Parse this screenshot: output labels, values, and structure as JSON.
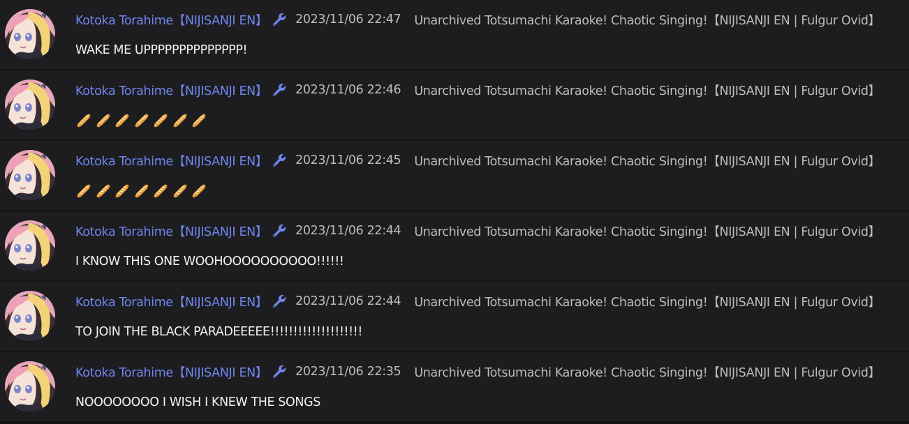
{
  "messages": [
    {
      "author": "Kotoka Torahime【NIJISANJI EN】",
      "badge_icon": "wrench-icon",
      "timestamp": "2023/11/06 22:47",
      "source": "Unarchived Totsumachi Karaoke! Chaotic Singing!【NIJISANJI EN | Fulgur Ovid】",
      "text": "WAKE ME UPPPPPPPPPPPPPP!"
    },
    {
      "author": "Kotoka Torahime【NIJISANJI EN】",
      "badge_icon": "wrench-icon",
      "timestamp": "2023/11/06 22:46",
      "source": "Unarchived Totsumachi Karaoke! Chaotic Singing!【NIJISANJI EN | Fulgur Ovid】",
      "emoji_name": "baguette-bread-icon",
      "emoji_count": 7
    },
    {
      "author": "Kotoka Torahime【NIJISANJI EN】",
      "badge_icon": "wrench-icon",
      "timestamp": "2023/11/06 22:45",
      "source": "Unarchived Totsumachi Karaoke! Chaotic Singing!【NIJISANJI EN | Fulgur Ovid】",
      "emoji_name": "baguette-bread-icon",
      "emoji_count": 7
    },
    {
      "author": "Kotoka Torahime【NIJISANJI EN】",
      "badge_icon": "wrench-icon",
      "timestamp": "2023/11/06 22:44",
      "source": "Unarchived Totsumachi Karaoke! Chaotic Singing!【NIJISANJI EN | Fulgur Ovid】",
      "text": "I KNOW THIS ONE WOOHOOOOOOOOOO!!!!!!"
    },
    {
      "author": "Kotoka Torahime【NIJISANJI EN】",
      "badge_icon": "wrench-icon",
      "timestamp": "2023/11/06 22:44",
      "source": "Unarchived Totsumachi Karaoke! Chaotic Singing!【NIJISANJI EN | Fulgur Ovid】",
      "text": "TO JOIN THE BLACK PARADEEEEE!!!!!!!!!!!!!!!!!!!!"
    },
    {
      "author": "Kotoka Torahime【NIJISANJI EN】",
      "badge_icon": "wrench-icon",
      "timestamp": "2023/11/06 22:35",
      "source": "Unarchived Totsumachi Karaoke! Chaotic Singing!【NIJISANJI EN | Fulgur Ovid】",
      "text": "NOOOOOOOO I WISH I KNEW THE SONGS"
    }
  ],
  "colors": {
    "author": "#6f86ee",
    "meta": "#bcbcbc",
    "message": "#f2f2f2",
    "row_background": "#1d1d1f"
  }
}
